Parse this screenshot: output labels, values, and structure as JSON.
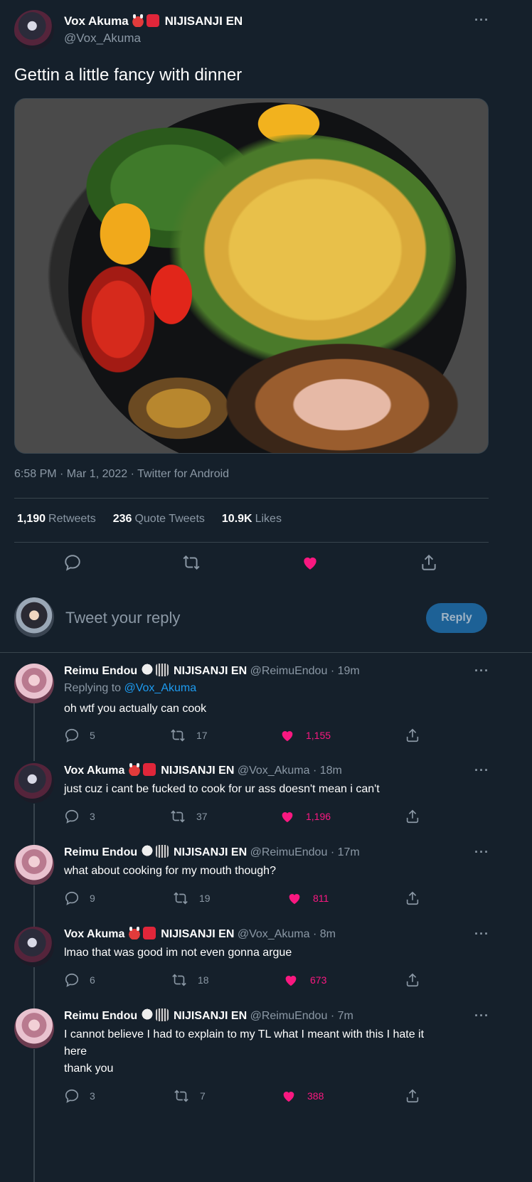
{
  "main_tweet": {
    "author_name": "Vox Akuma",
    "author_emojis": [
      "oni-emoji",
      "red-envelope-emoji"
    ],
    "author_affiliation": "NIJISANJI EN",
    "author_handle": "@Vox_Akuma",
    "text": "Gettin a little fancy with dinner",
    "image_description_icon": "food-photo",
    "timestamp": "6:58 PM · Mar 1, 2022 · Twitter for Android",
    "stats": {
      "retweets_count": "1,190",
      "retweets_label": "Retweets",
      "quotes_count": "236",
      "quotes_label": "Quote Tweets",
      "likes_count": "10.9K",
      "likes_label": "Likes"
    },
    "liked": true
  },
  "reply_box": {
    "placeholder": "Tweet your reply",
    "button_label": "Reply"
  },
  "replies": [
    {
      "name": "Reimu Endou",
      "emojis": [
        "ghost-emoji",
        "slides-emoji"
      ],
      "affiliation": "NIJISANJI EN",
      "handle": "@ReimuEndou",
      "time": "· 19m",
      "replying_prefix": "Replying to",
      "replying_to": "@Vox_Akuma",
      "text": "oh wtf you actually can cook",
      "replies": "5",
      "retweets": "17",
      "likes": "1,155"
    },
    {
      "name": "Vox Akuma",
      "emojis": [
        "oni-emoji",
        "red-envelope-emoji"
      ],
      "affiliation": "NIJISANJI EN",
      "handle": "@Vox_Akuma",
      "time": "· 18m",
      "text": "just cuz i cant be fucked to cook for ur ass doesn't mean i can't",
      "replies": "3",
      "retweets": "37",
      "likes": "1,196"
    },
    {
      "name": "Reimu Endou",
      "emojis": [
        "ghost-emoji",
        "slides-emoji"
      ],
      "affiliation": "NIJISANJI EN",
      "handle": "@ReimuEndou",
      "time": "· 17m",
      "text": "what about cooking for my mouth though?",
      "replies": "9",
      "retweets": "19",
      "likes": "811"
    },
    {
      "name": "Vox Akuma",
      "emojis": [
        "oni-emoji",
        "red-envelope-emoji"
      ],
      "affiliation": "NIJISANJI EN",
      "handle": "@Vox_Akuma",
      "time": "· 8m",
      "text": "lmao that was good im not even gonna argue",
      "replies": "6",
      "retweets": "18",
      "likes": "673"
    },
    {
      "name": "Reimu Endou",
      "emojis": [
        "ghost-emoji",
        "slides-emoji"
      ],
      "affiliation": "NIJISANJI EN",
      "handle": "@ReimuEndou",
      "time": "· 7m",
      "text_line1": "I cannot believe I had to explain to my TL what I meant with this I hate it",
      "text_line2": "here",
      "text_line3": "thank you",
      "replies": "3",
      "retweets": "7",
      "likes": "388"
    }
  ],
  "colors": {
    "background": "#15202b",
    "text_secondary": "#8b98a5",
    "like_pink": "#f91880",
    "link_blue": "#1d9bf0",
    "reply_button": "#1d6196",
    "divider": "#38444d"
  }
}
